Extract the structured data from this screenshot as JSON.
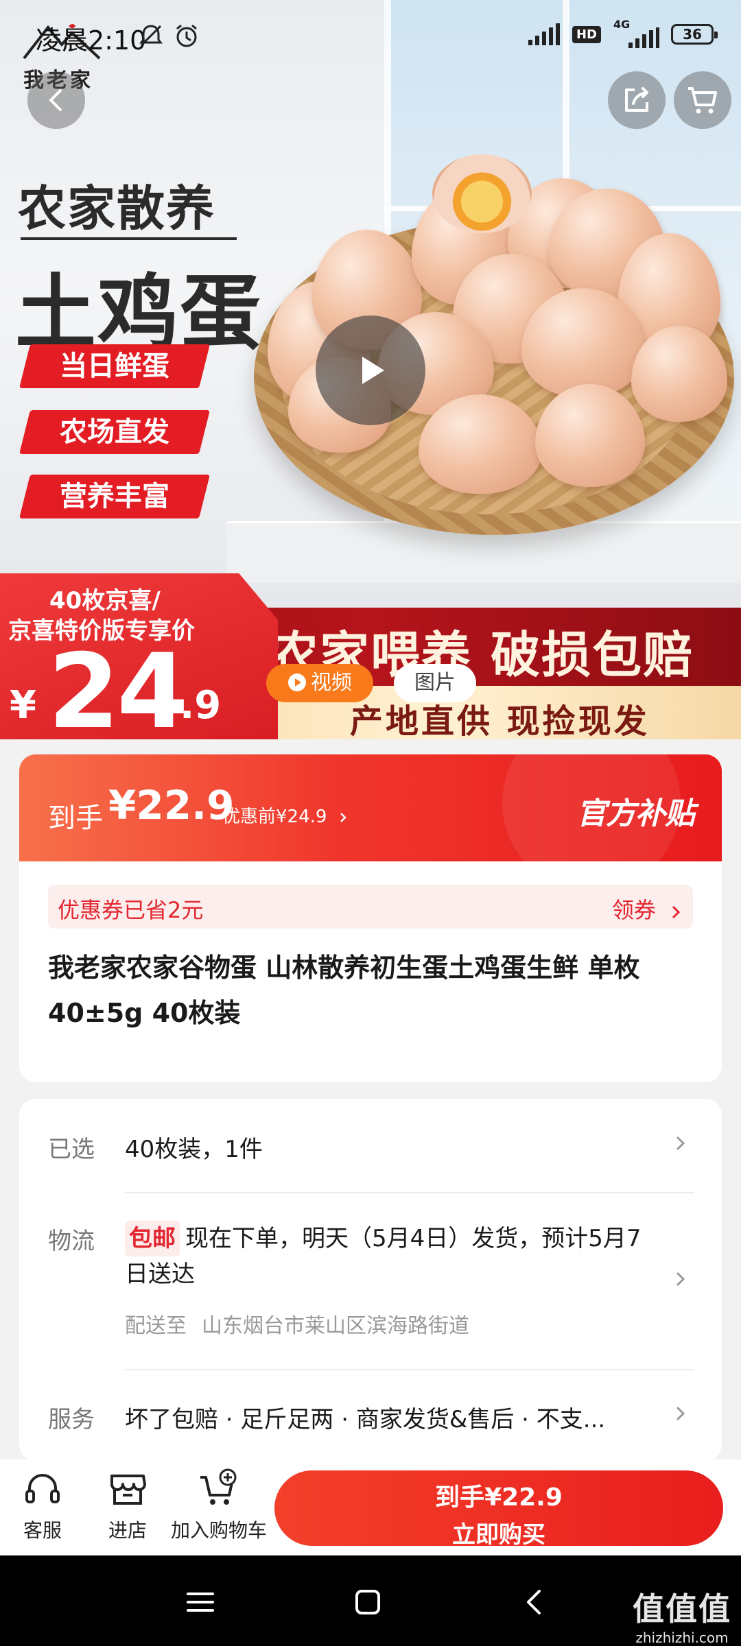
{
  "status_bar": {
    "time": "凌晨2:10",
    "network": "4G",
    "hd": "HD",
    "battery": "36"
  },
  "brand_logo": {
    "text": "我老家"
  },
  "hero": {
    "title_line1": "农家散养",
    "title_line2": "土鸡蛋",
    "tags": [
      "当日鲜蛋",
      "农场直发",
      "营养丰富"
    ],
    "price_badge": {
      "line1": "40枚京喜/",
      "line2": "京喜特价版专享价",
      "currency": "¥",
      "price_int": "24",
      "price_dec": ".9"
    },
    "slogan_line1": "农家喂养 破损包赔",
    "slogan_line2": "产地直供 现捡现发",
    "media_tabs": {
      "video": "视频",
      "video_icon": "play-circle-icon",
      "pictures": "图片"
    }
  },
  "price_card": {
    "final_label": "到手",
    "final_price": "¥22.9",
    "before_discount": "优惠前¥24.9",
    "subsidy_label": "官方补贴",
    "coupon_text": "优惠券已省2元",
    "coupon_link": "领券",
    "product_title": "我老家农家谷物蛋 山林散养初生蛋土鸡蛋生鲜 单枚40±5g 40枚装"
  },
  "info_card": {
    "selected_label": "已选",
    "selected_value": "40枚装，1件",
    "logistics_label": "物流",
    "free_shipping": "包邮",
    "logistics_text": "现在下单，明天（5月4日）发货，预计5月7日送达",
    "deliver_to_label": "配送至",
    "deliver_to_address": "山东烟台市莱山区滨海路街道",
    "service_label": "服务",
    "service_text": "坏了包赔 · 足斤足两 · 商家发货&售后 · 不支..."
  },
  "bottom_bar": {
    "customer_service": "客服",
    "store": "进店",
    "add_to_cart": "加入购物车",
    "buy_line1": "到手¥22.9",
    "buy_line2": "立即购买"
  },
  "watermark": {
    "line1": "值值值",
    "line2": "zhizhizhi.com"
  },
  "colors": {
    "accent_red": "#e3262f",
    "price_gradient_start": "#f7714b",
    "price_gradient_end": "#e81b1c",
    "video_tab_orange": "#f97a1a"
  }
}
